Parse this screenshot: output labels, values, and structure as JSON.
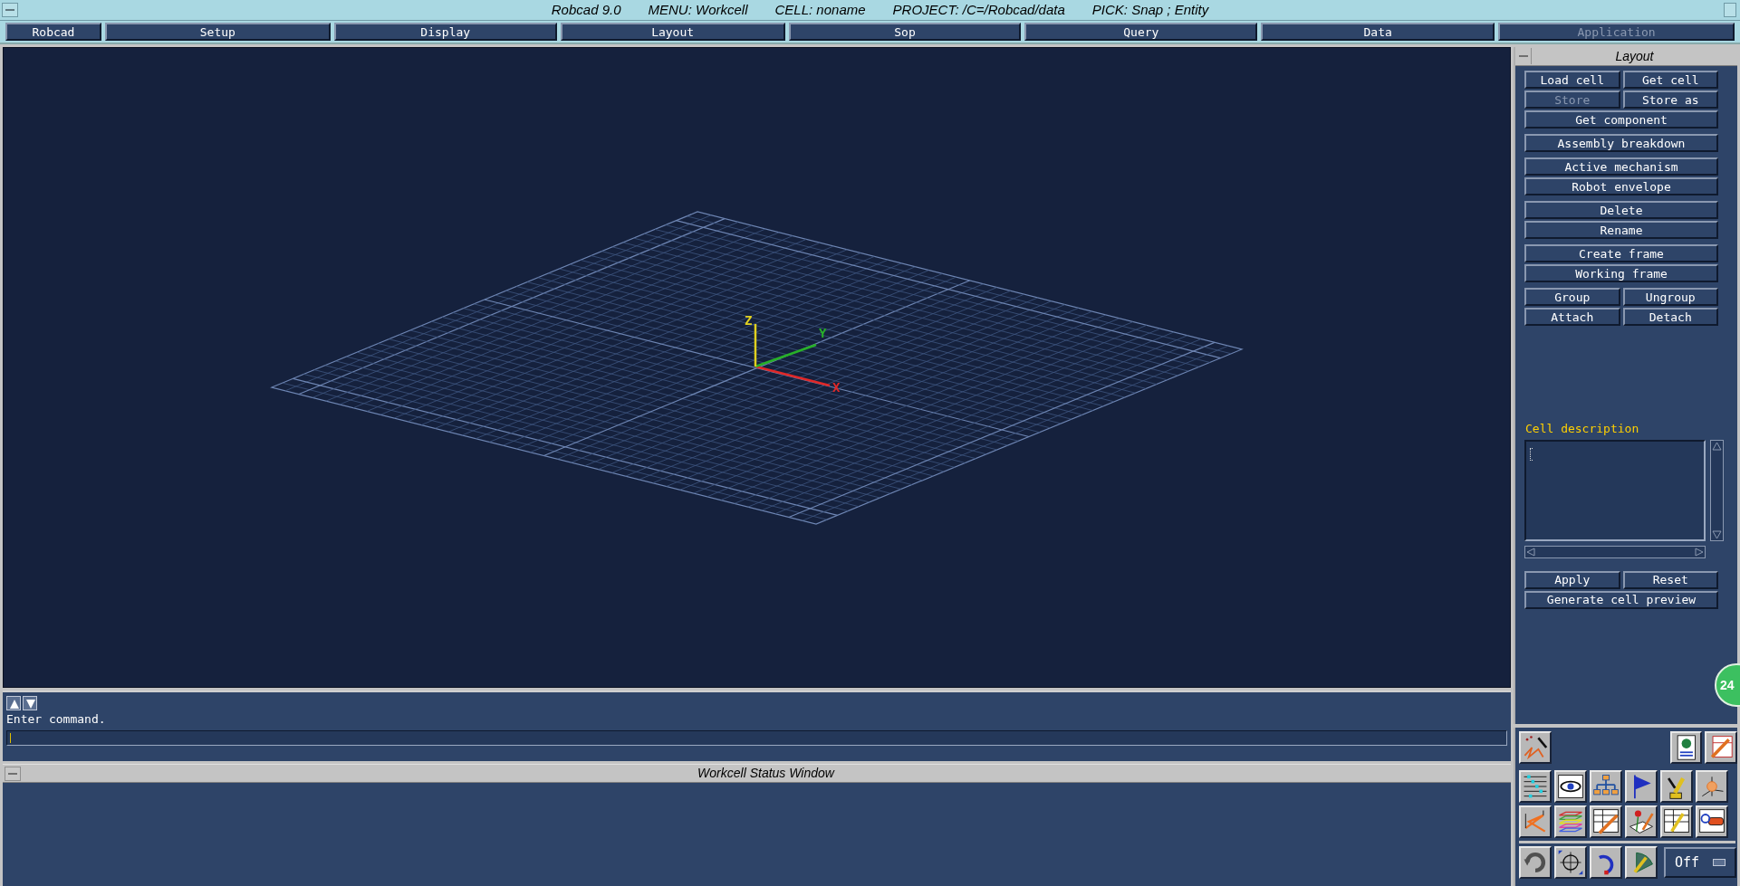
{
  "title_bar": {
    "items": [
      "Robcad 9.0",
      "MENU: Workcell",
      "CELL: noname",
      "PROJECT: /C=/Robcad/data",
      "PICK: Snap ; Entity"
    ]
  },
  "menu_bar": [
    {
      "label": "Robcad",
      "disabled": false
    },
    {
      "label": "Setup",
      "disabled": false
    },
    {
      "label": "Display",
      "disabled": false
    },
    {
      "label": "Layout",
      "disabled": false
    },
    {
      "label": "Sop",
      "disabled": false
    },
    {
      "label": "Query",
      "disabled": false
    },
    {
      "label": "Data",
      "disabled": false
    },
    {
      "label": "Application",
      "disabled": true
    }
  ],
  "viewport": {
    "axes": [
      {
        "label": "X",
        "color": "#e02828"
      },
      {
        "label": "Y",
        "color": "#28b028"
      },
      {
        "label": "Z",
        "color": "#e0d020"
      }
    ]
  },
  "command_area": {
    "prompt": "Enter command."
  },
  "status_window": {
    "title": "Workcell Status Window"
  },
  "layout_panel": {
    "title": "Layout",
    "button_groups": [
      [
        [
          {
            "label": "Load cell",
            "disabled": false
          },
          {
            "label": "Get cell",
            "disabled": false
          }
        ],
        [
          {
            "label": "Store",
            "disabled": true
          },
          {
            "label": "Store as",
            "disabled": false
          }
        ],
        [
          {
            "label": "Get component",
            "disabled": false
          }
        ]
      ],
      [
        [
          {
            "label": "Assembly breakdown",
            "disabled": false
          }
        ]
      ],
      [
        [
          {
            "label": "Active mechanism",
            "disabled": false
          }
        ],
        [
          {
            "label": "Robot envelope",
            "disabled": false
          }
        ]
      ],
      [
        [
          {
            "label": "Delete",
            "disabled": false
          }
        ],
        [
          {
            "label": "Rename",
            "disabled": false
          }
        ]
      ],
      [
        [
          {
            "label": "Create frame",
            "disabled": false
          }
        ],
        [
          {
            "label": "Working frame",
            "disabled": false
          }
        ]
      ],
      [
        [
          {
            "label": "Group",
            "disabled": false
          },
          {
            "label": "Ungroup",
            "disabled": false
          }
        ],
        [
          {
            "label": "Attach",
            "disabled": false
          },
          {
            "label": "Detach",
            "disabled": false
          }
        ]
      ]
    ],
    "cell_description_label": "Cell description",
    "action_buttons": [
      [
        {
          "label": "Apply",
          "disabled": false
        },
        {
          "label": "Reset",
          "disabled": false
        }
      ],
      [
        {
          "label": "Generate cell preview",
          "disabled": false
        }
      ]
    ]
  },
  "toolbar": {
    "toggle_value": "Off"
  },
  "overlay_badge": "24"
}
